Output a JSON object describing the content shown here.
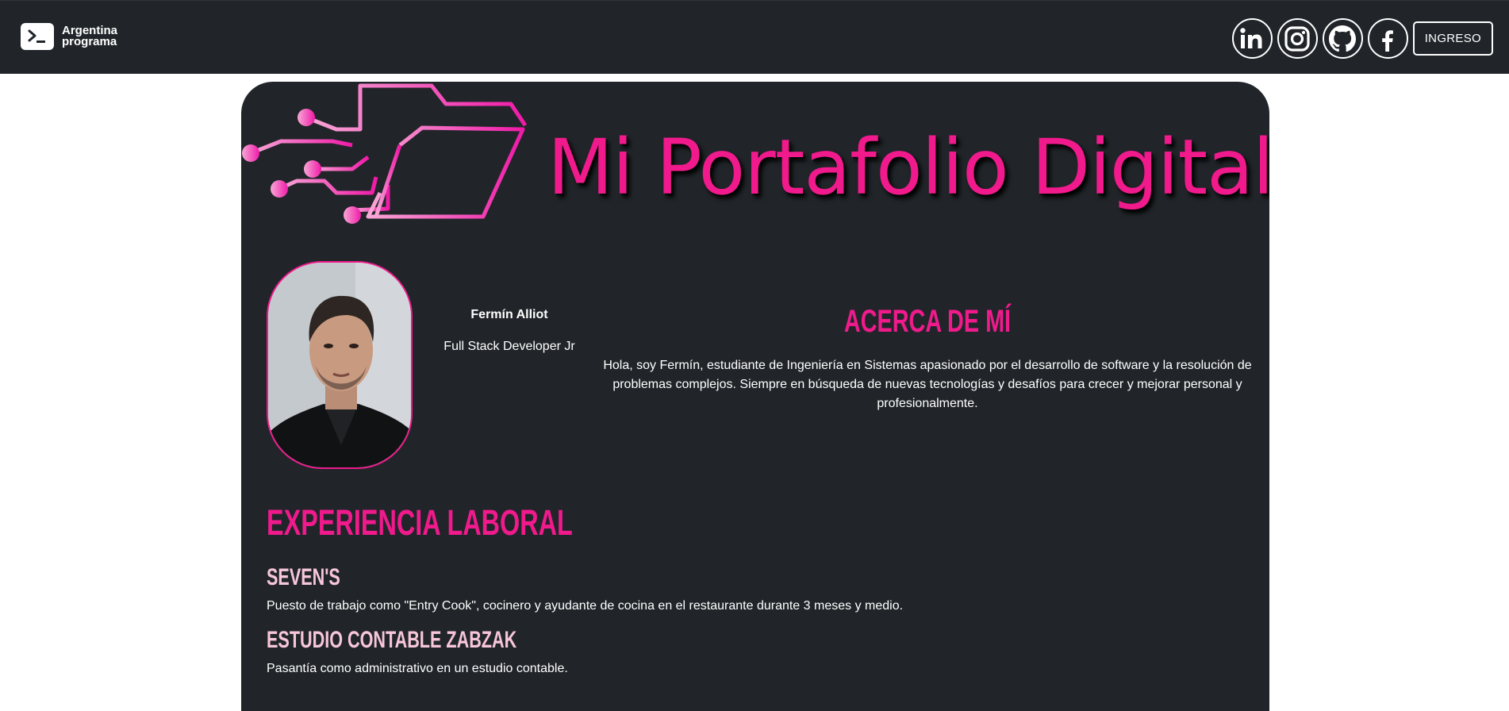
{
  "navbar": {
    "brand": {
      "line1": "Argentina",
      "line2": "programa"
    },
    "social": [
      {
        "name": "linkedin-icon",
        "label": "in"
      },
      {
        "name": "instagram-icon",
        "label": "instagram"
      },
      {
        "name": "github-icon",
        "label": "github"
      },
      {
        "name": "facebook-icon",
        "label": "f"
      }
    ],
    "login_label": "INGRESO"
  },
  "banner": {
    "title": "Mi Portafolio Digital"
  },
  "profile": {
    "name": "Fermín Alliot",
    "role": "Full Stack Developer Jr"
  },
  "about": {
    "title": "ACERCA DE MÍ",
    "text": "Hola, soy Fermín, estudiante de Ingeniería en Sistemas apasionado por el desarrollo de software y la resolución de problemas complejos. Siempre en búsqueda de nuevas tecnologías y desafíos para crecer y mejorar personal y profesionalmente."
  },
  "experience": {
    "title": "EXPERIENCIA LABORAL",
    "jobs": [
      {
        "company": "SEVEN'S",
        "description": "Puesto de trabajo como \"Entry Cook\", cocinero y ayudante de cocina en el restaurante durante 3 meses y medio."
      },
      {
        "company": "ESTUDIO CONTABLE ZABZAK",
        "description": "Pasantía como administrativo en un estudio contable."
      }
    ]
  },
  "colors": {
    "accent": "#f01a8c",
    "subtitle": "#f7c6d9",
    "panel": "#212529",
    "navbar": "#212529"
  }
}
